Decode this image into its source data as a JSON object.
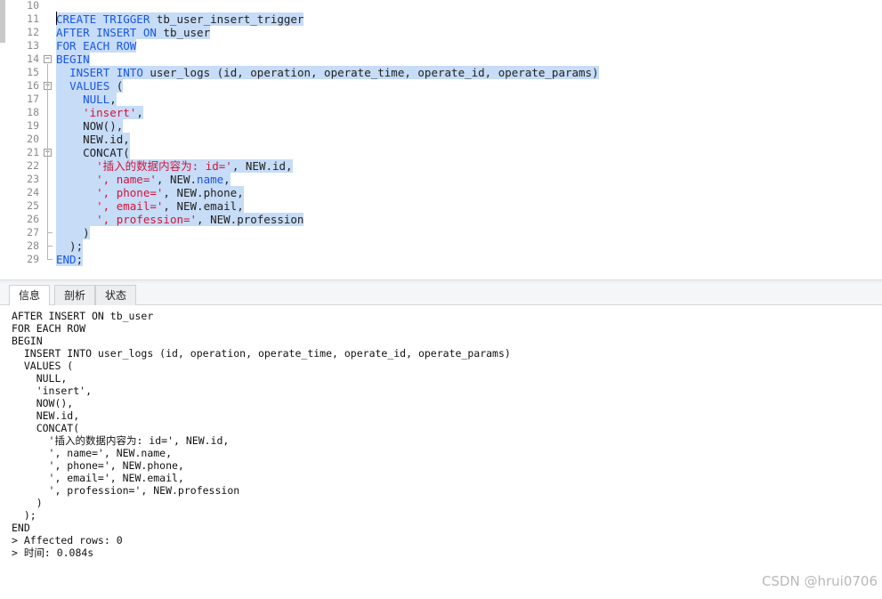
{
  "editor": {
    "lines": [
      {
        "num": "10",
        "tokens": []
      },
      {
        "num": "11",
        "tokens": [
          {
            "t": "CREATE TRIGGER",
            "c": "kw"
          },
          {
            "t": " tb_user_insert_trigger",
            "c": "txt"
          }
        ]
      },
      {
        "num": "12",
        "tokens": [
          {
            "t": "AFTER INSERT ON",
            "c": "kw"
          },
          {
            "t": " tb_user",
            "c": "txt"
          }
        ]
      },
      {
        "num": "13",
        "tokens": [
          {
            "t": "FOR EACH ROW",
            "c": "kw"
          }
        ]
      },
      {
        "num": "14",
        "tokens": [
          {
            "t": "BEGIN",
            "c": "kw"
          }
        ]
      },
      {
        "num": "15",
        "tokens": [
          {
            "t": "  ",
            "c": "txt"
          },
          {
            "t": "INSERT INTO",
            "c": "kw"
          },
          {
            "t": " user_logs (id, operation, operate_time, operate_id, operate_params)",
            "c": "txt"
          }
        ]
      },
      {
        "num": "16",
        "tokens": [
          {
            "t": "  ",
            "c": "txt"
          },
          {
            "t": "VALUES",
            "c": "kw"
          },
          {
            "t": " (",
            "c": "txt"
          }
        ]
      },
      {
        "num": "17",
        "tokens": [
          {
            "t": "    ",
            "c": "txt"
          },
          {
            "t": "NULL",
            "c": "kw"
          },
          {
            "t": ",",
            "c": "txt"
          }
        ]
      },
      {
        "num": "18",
        "tokens": [
          {
            "t": "    ",
            "c": "txt"
          },
          {
            "t": "'insert'",
            "c": "str"
          },
          {
            "t": ",",
            "c": "txt"
          }
        ]
      },
      {
        "num": "19",
        "tokens": [
          {
            "t": "    NOW(),",
            "c": "txt"
          }
        ]
      },
      {
        "num": "20",
        "tokens": [
          {
            "t": "    NEW.id,",
            "c": "txt"
          }
        ]
      },
      {
        "num": "21",
        "tokens": [
          {
            "t": "    CONCAT(",
            "c": "txt"
          }
        ]
      },
      {
        "num": "22",
        "tokens": [
          {
            "t": "      ",
            "c": "txt"
          },
          {
            "t": "'插入的数据内容为: id='",
            "c": "str"
          },
          {
            "t": ", NEW.id,",
            "c": "txt"
          }
        ]
      },
      {
        "num": "23",
        "tokens": [
          {
            "t": "      ",
            "c": "txt"
          },
          {
            "t": "', name='",
            "c": "str"
          },
          {
            "t": ", NEW.",
            "c": "txt"
          },
          {
            "t": "name",
            "c": "kw"
          },
          {
            "t": ",",
            "c": "txt"
          }
        ]
      },
      {
        "num": "24",
        "tokens": [
          {
            "t": "      ",
            "c": "txt"
          },
          {
            "t": "', phone='",
            "c": "str"
          },
          {
            "t": ", NEW.phone,",
            "c": "txt"
          }
        ]
      },
      {
        "num": "25",
        "tokens": [
          {
            "t": "      ",
            "c": "txt"
          },
          {
            "t": "', email='",
            "c": "str"
          },
          {
            "t": ", NEW.email,",
            "c": "txt"
          }
        ]
      },
      {
        "num": "26",
        "tokens": [
          {
            "t": "      ",
            "c": "txt"
          },
          {
            "t": "', profession='",
            "c": "str"
          },
          {
            "t": ", NEW.profession",
            "c": "txt"
          }
        ]
      },
      {
        "num": "27",
        "tokens": [
          {
            "t": "    )",
            "c": "txt"
          }
        ]
      },
      {
        "num": "28",
        "tokens": [
          {
            "t": "  );",
            "c": "txt"
          }
        ]
      },
      {
        "num": "29",
        "tokens": [
          {
            "t": "END",
            "c": "kw"
          },
          {
            "t": ";",
            "c": "txt"
          }
        ]
      }
    ]
  },
  "tabs": [
    {
      "label": "信息",
      "active": true
    },
    {
      "label": "剖析",
      "active": false
    },
    {
      "label": "状态",
      "active": false
    }
  ],
  "output": {
    "lines": [
      "AFTER INSERT ON tb_user",
      "FOR EACH ROW",
      "BEGIN",
      "  INSERT INTO user_logs (id, operation, operate_time, operate_id, operate_params)",
      "  VALUES (",
      "    NULL,",
      "    'insert',",
      "    NOW(),",
      "    NEW.id,",
      "    CONCAT(",
      "      '插入的数据内容为: id=', NEW.id,",
      "      ', name=', NEW.name,",
      "      ', phone=', NEW.phone,",
      "      ', email=', NEW.email,",
      "      ', profession=', NEW.profession",
      "    )",
      "  );",
      "END",
      "> Affected rows: 0",
      "> 时间: 0.084s"
    ]
  },
  "watermark": "CSDN @hrui0706",
  "colors": {
    "keyword": "#1a56e8",
    "string": "#d2143a",
    "selection": "#c6dcf7"
  }
}
